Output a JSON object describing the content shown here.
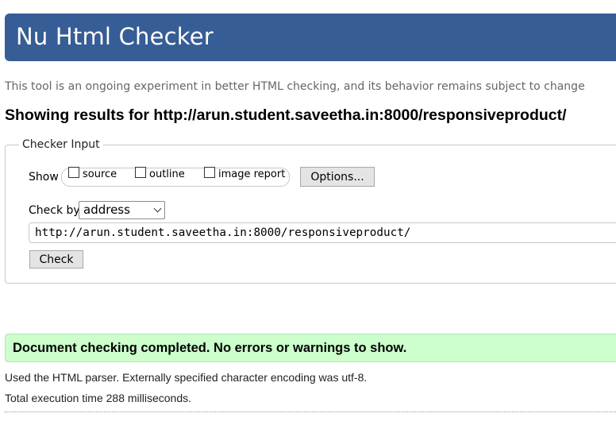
{
  "header": {
    "title": "Nu Html Checker"
  },
  "tagline": "This tool is an ongoing experiment in better HTML checking, and its behavior remains subject to change",
  "results_heading": "Showing results for http://arun.student.saveetha.in:8000/responsiveproduct/",
  "checker_input": {
    "legend": "Checker Input",
    "show_label": "Show",
    "options": [
      {
        "label": "source",
        "checked": false
      },
      {
        "label": "outline",
        "checked": false
      },
      {
        "label": "image report",
        "checked": false
      }
    ],
    "options_button": "Options...",
    "check_by_label": "Check by",
    "check_by_value": "address",
    "url_value": "http://arun.student.saveetha.in:8000/responsiveproduct/",
    "check_button": "Check"
  },
  "status": {
    "message": "Document checking completed. No errors or warnings to show.",
    "color": "#ccffcc"
  },
  "info": {
    "parser": "Used the HTML parser. Externally specified character encoding was utf-8.",
    "time": "Total execution time 288 milliseconds."
  },
  "colors": {
    "header_bg": "#365d95"
  }
}
